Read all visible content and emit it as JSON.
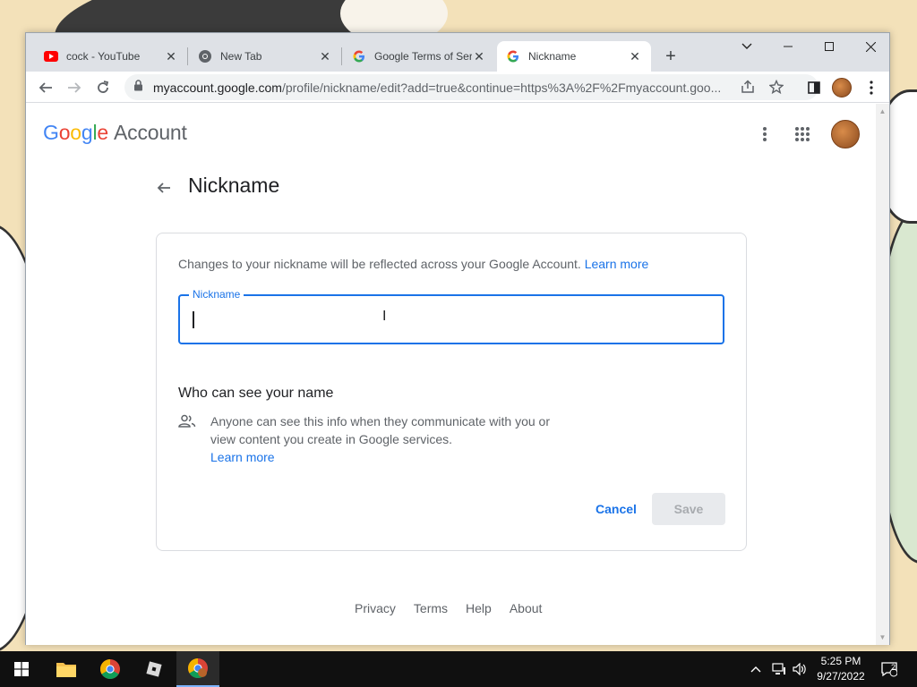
{
  "tabs": [
    {
      "title": "cock - YouTube",
      "favicon": "youtube-icon",
      "active": false
    },
    {
      "title": "New Tab",
      "favicon": "chrome-icon",
      "active": false
    },
    {
      "title": "Google Terms of Ser",
      "favicon": "google-g-icon",
      "active": false
    },
    {
      "title": "Nickname",
      "favicon": "google-g-icon",
      "active": true
    }
  ],
  "toolbar": {
    "url_host": "myaccount.google.com",
    "url_path": "/profile/nickname/edit?add=true&continue=https%3A%2F%2Fmyaccount.goo..."
  },
  "header": {
    "logo_google": "Google",
    "logo_account": "Account"
  },
  "main": {
    "title": "Nickname",
    "description": "Changes to your nickname will be reflected across your Google Account.",
    "learn_more": "Learn more",
    "field_label": "Nickname",
    "field_value": "",
    "who_heading": "Who can see your name",
    "who_desc": "Anyone can see this info when they communicate with you or view content you create in Google services.",
    "who_learn_more": "Learn more",
    "cancel": "Cancel",
    "save": "Save"
  },
  "footer": [
    "Privacy",
    "Terms",
    "Help",
    "About"
  ],
  "taskbar": {
    "time": "5:25 PM",
    "date": "9/27/2022",
    "notifications": "2"
  },
  "colors": {
    "accent": "#1a73e8",
    "google_blue": "#4285f4",
    "google_red": "#ea4335",
    "google_yellow": "#fbbc05",
    "google_green": "#34a853"
  }
}
